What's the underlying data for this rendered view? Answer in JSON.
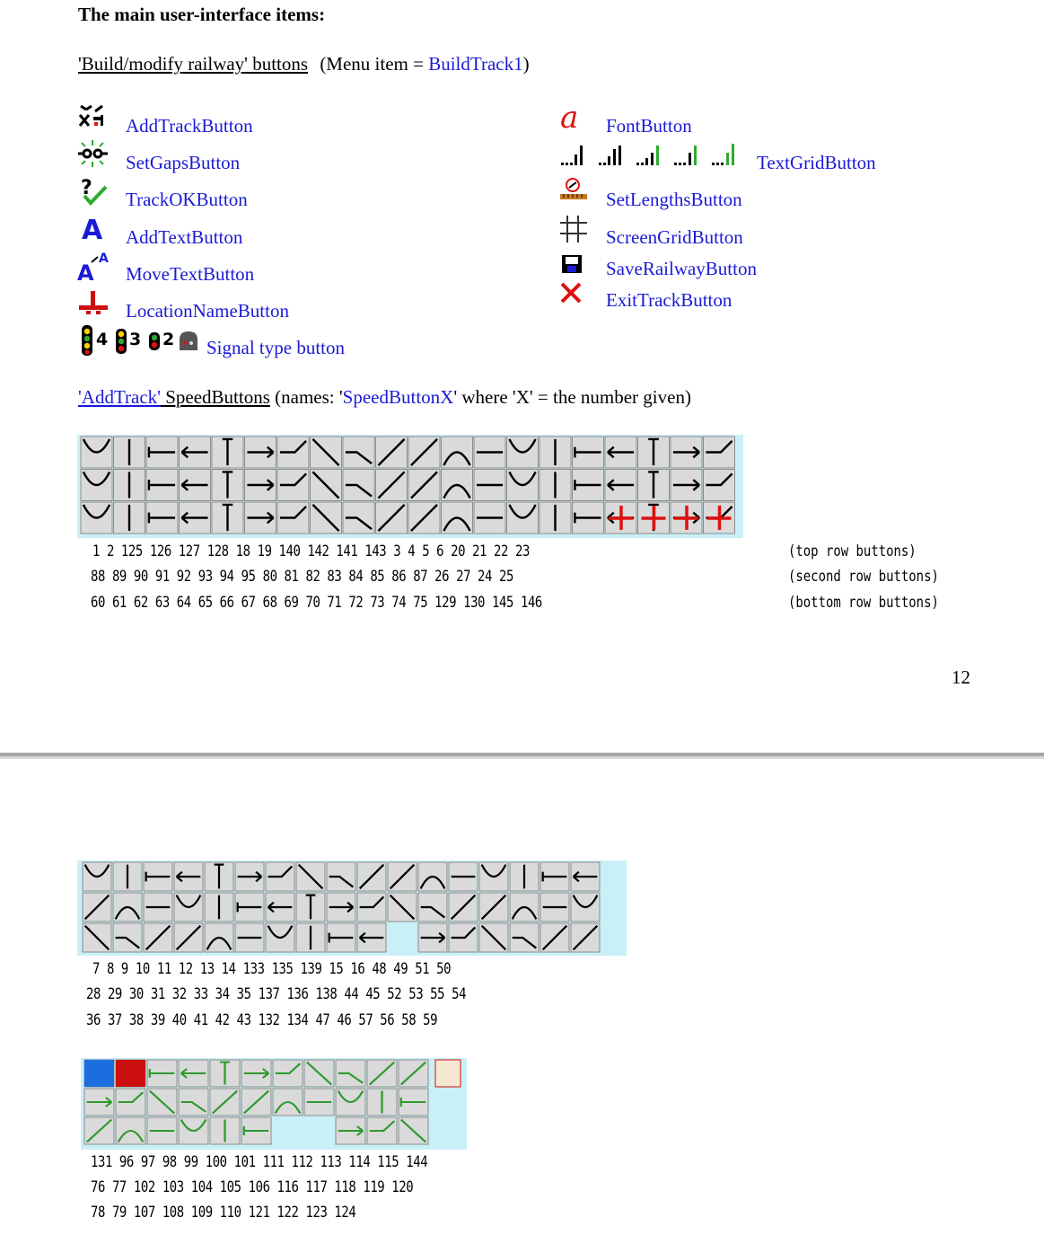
{
  "page": {
    "heading": "The main user-interface items:",
    "page_number": "12"
  },
  "section1": {
    "title": "'Build/modify railway' buttons",
    "menu_prefix": "(Menu item = ",
    "menu_item": "BuildTrack1",
    "menu_suffix": ")",
    "left_items": [
      {
        "label": "AddTrackButton",
        "icon": "add-track-icon"
      },
      {
        "label": "SetGapsButton",
        "icon": "set-gaps-icon"
      },
      {
        "label": "TrackOKButton",
        "icon": "track-ok-icon"
      },
      {
        "label": "AddTextButton",
        "icon": "add-text-icon"
      },
      {
        "label": "MoveTextButton",
        "icon": "move-text-icon"
      },
      {
        "label": "LocationNameButton",
        "icon": "location-name-icon"
      },
      {
        "label": "Signal type button",
        "icon": "signal-type-icon"
      }
    ],
    "signal_counts": [
      "4",
      "3",
      "2"
    ],
    "right_items": [
      {
        "label": "FontButton",
        "icon": "font-icon"
      },
      {
        "label": "TextGridButton",
        "icon": "text-grid-icon"
      },
      {
        "label": "SetLengthsButton",
        "icon": "set-lengths-icon"
      },
      {
        "label": "ScreenGridButton",
        "icon": "screen-grid-icon"
      },
      {
        "label": "SaveRailwayButton",
        "icon": "save-icon"
      },
      {
        "label": "ExitTrackButton",
        "icon": "exit-icon"
      }
    ]
  },
  "section2": {
    "title_link": "'AddTrack'",
    "title_rest": " SpeedButtons",
    "desc_prefix": " (names: '",
    "desc_link": "SpeedButtonX",
    "desc_suffix": "' where 'X' = the number given)",
    "rows": [
      "1  2 125 126 127 128  18  19  140 142  141 143  3   4   5  6   20  21  22  23",
      "88 89  90  91  92  93  94  95  80  81  82 83  84  85  86 87  26  27  24  25",
      "60 61  62 63  64  65  66  67  68  69  70  71  72  73  74  75  129 130 145 146"
    ],
    "row_captions": [
      "(top row buttons)",
      "(second row buttons)",
      "(bottom row buttons)"
    ]
  },
  "grid2": {
    "rows": [
      "7  8   9  10  11  12  13  14 133 135 139  15  16  48  49 51  50",
      "28 29  30 31  32  33  34  35 137 136 138  44  45  52  53 55  54",
      "36 37  38 39  40  41  42  43 132 134       47  46  57  56 58  59"
    ]
  },
  "grid3": {
    "rows": [
      "131 96  97 98  99 100 101 111 112 113 114 115 144",
      "76  77 102 103 104 105 106 116 117 118 119 120",
      "78  79 107 108 109 110     121 122 123 124"
    ]
  },
  "colors": {
    "link": "#1a1ad6",
    "panel": "#c9f0f6",
    "button": "#dadada",
    "track_green": "#2e9a2e",
    "accent_red": "#e01010"
  }
}
